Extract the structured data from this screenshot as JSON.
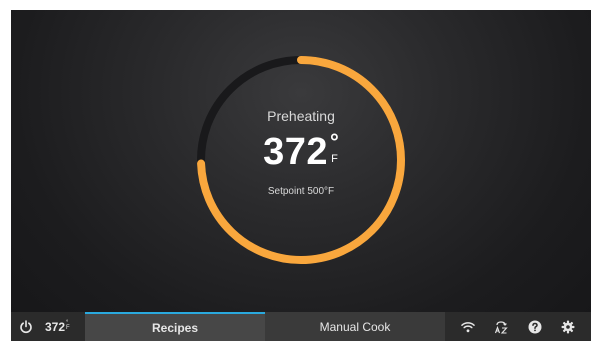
{
  "status": {
    "label": "Preheating",
    "temperature": "372",
    "degree_symbol": "°",
    "unit": "F",
    "setpoint": "Setpoint 500°F",
    "progress_fraction": 0.744
  },
  "bottombar": {
    "mini_temp": "372",
    "mini_temp_degree": "°",
    "mini_temp_unit": "F",
    "tabs": [
      {
        "label": "Recipes",
        "active": true
      },
      {
        "label": "Manual Cook",
        "active": false
      }
    ],
    "icons": [
      "wifi-icon",
      "language-icon",
      "help-icon",
      "settings-icon"
    ]
  },
  "colors": {
    "accent_orange": "#f9a73d",
    "track": "#19191b",
    "tab_active_indicator": "#2aa9de"
  }
}
